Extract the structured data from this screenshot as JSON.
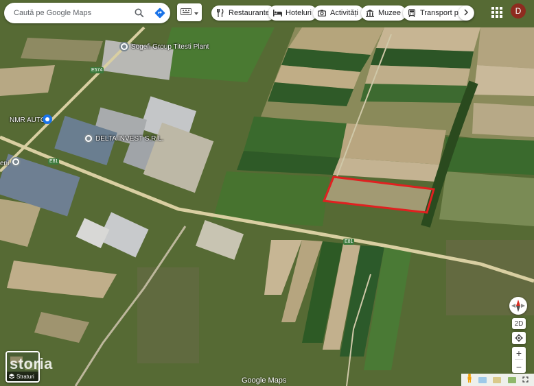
{
  "search": {
    "placeholder": "Caută pe Google Maps"
  },
  "chips": [
    {
      "label": "Restaurante",
      "icon": "fork-knife-icon"
    },
    {
      "label": "Hoteluri",
      "icon": "bed-icon"
    },
    {
      "label": "Activități",
      "icon": "camera-icon"
    },
    {
      "label": "Muzee",
      "icon": "museum-icon"
    },
    {
      "label": "Transport publ",
      "icon": "transit-icon"
    }
  ],
  "account": {
    "initial": "D",
    "color": "#8e2b1f"
  },
  "places": [
    {
      "label": "Sogefi Group Titesti Plant"
    },
    {
      "label": "NMR AUTO"
    },
    {
      "label": "DELTA INVEST S.R.L."
    },
    {
      "label": "eni"
    }
  ],
  "roads": {
    "e574": "E574",
    "e81a": "E81",
    "e81b": "E81"
  },
  "controls": {
    "view_mode": "2D"
  },
  "layers": {
    "label": "Straturi"
  },
  "attribution": {
    "logo": "Google Maps",
    "watermark": "storia"
  },
  "highlight": {
    "color": "#e02020"
  }
}
